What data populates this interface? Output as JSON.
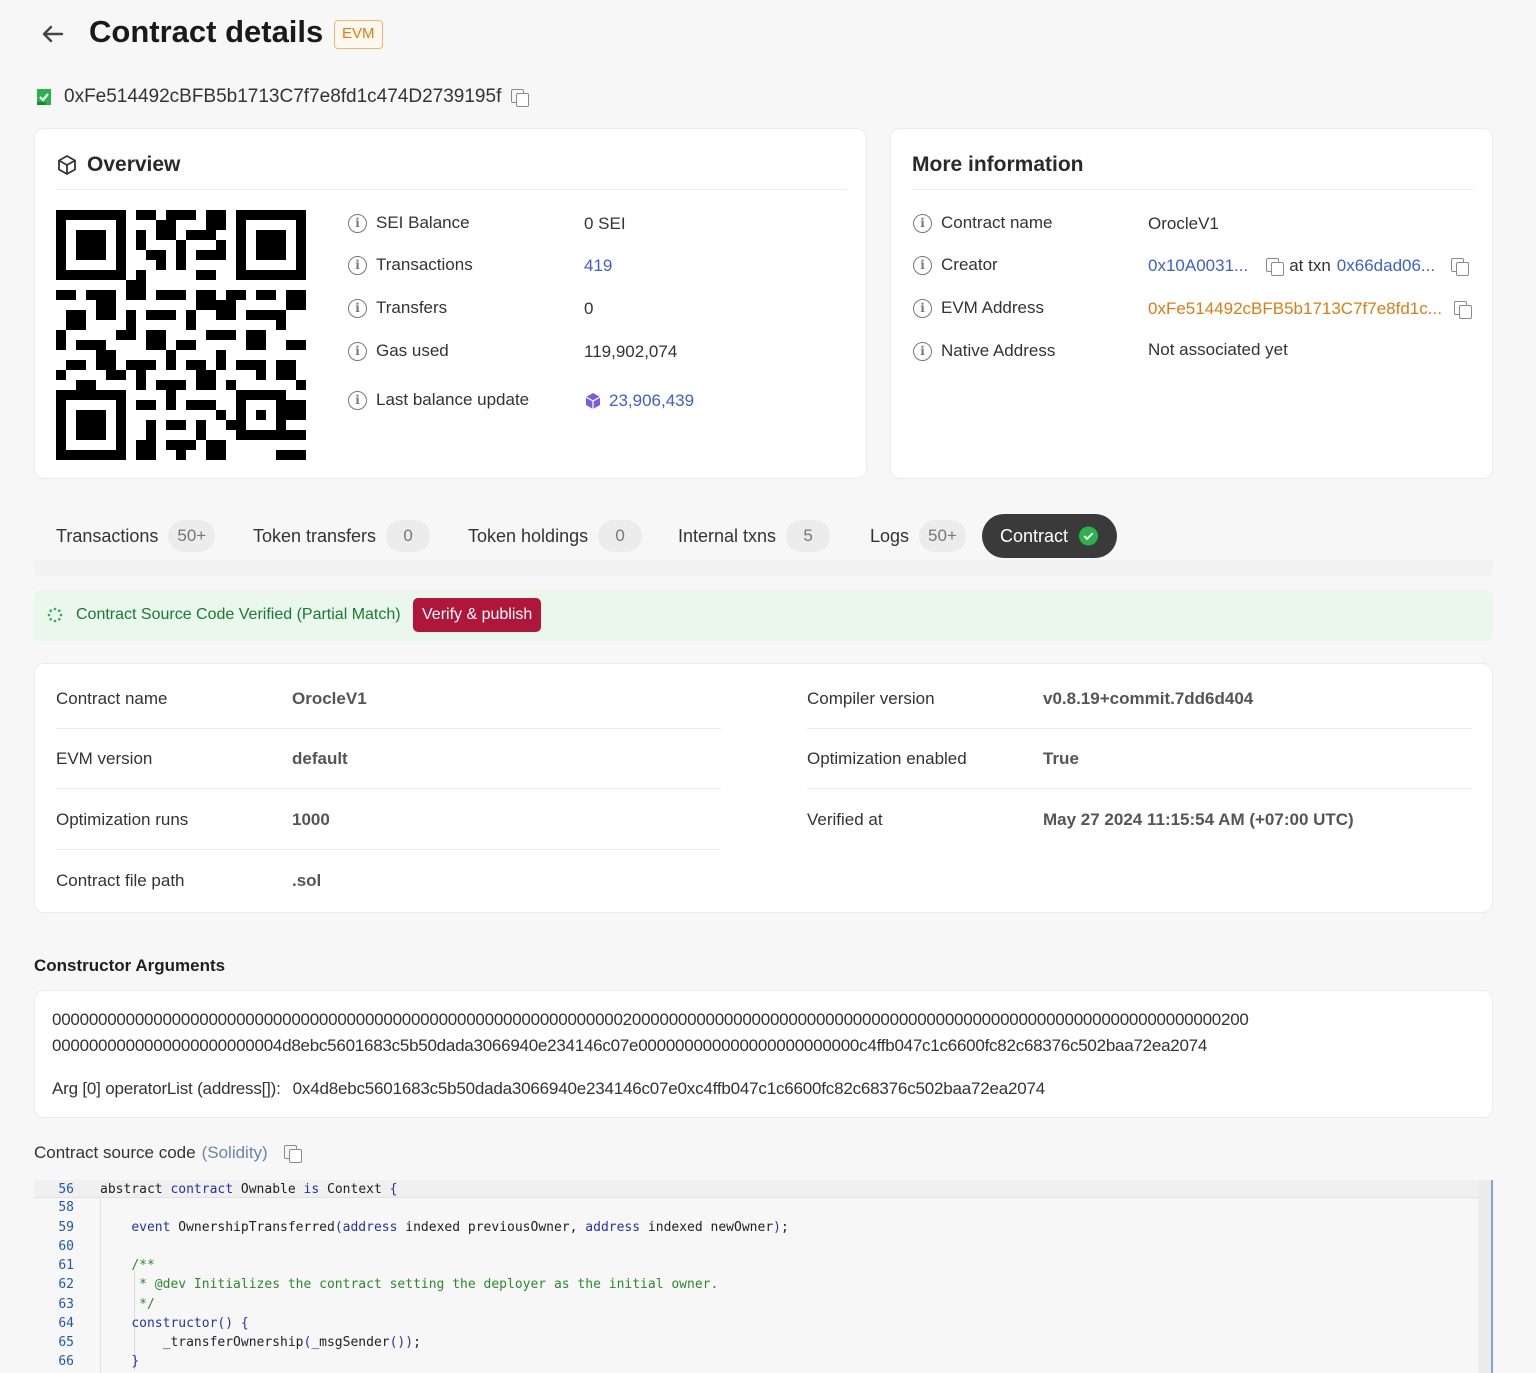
{
  "header": {
    "title": "Contract details",
    "badge": "EVM"
  },
  "address": {
    "value": "0xFe514492cBFB5b1713C7f7e8fd1c474D2739195f"
  },
  "overview": {
    "title": "Overview",
    "rows": [
      {
        "label": "SEI Balance",
        "value": "0 SEI"
      },
      {
        "label": "Transactions",
        "value": "419"
      },
      {
        "label": "Transfers",
        "value": "0"
      },
      {
        "label": "Gas used",
        "value": "119,902,074"
      },
      {
        "label": "Last balance update",
        "value": "23,906,439"
      }
    ]
  },
  "more_info": {
    "title": "More information",
    "contract_name_label": "Contract name",
    "contract_name": "OrocleV1",
    "creator_label": "Creator",
    "creator": "0x10A0031...",
    "at_txn": "at txn",
    "creator_txn": "0x66dad06...",
    "evm_address_label": "EVM Address",
    "evm_address": "0xFe514492cBFB5b1713C7f7e8fd1c...",
    "native_address_label": "Native Address",
    "native_address": "Not associated yet"
  },
  "tabs": [
    {
      "label": "Transactions",
      "count": "50+"
    },
    {
      "label": "Token transfers",
      "count": "0"
    },
    {
      "label": "Token holdings",
      "count": "0"
    },
    {
      "label": "Internal txns",
      "count": "5"
    },
    {
      "label": "Logs",
      "count": "50+"
    },
    {
      "label": "Contract"
    }
  ],
  "verify": {
    "text": "Contract Source Code Verified (Partial Match)",
    "button": "Verify & publish"
  },
  "details": {
    "left": [
      {
        "label": "Contract name",
        "value": "OrocleV1"
      },
      {
        "label": "EVM version",
        "value": "default"
      },
      {
        "label": "Optimization runs",
        "value": "1000"
      },
      {
        "label": "Contract file path",
        "value": ".sol"
      }
    ],
    "right": [
      {
        "label": "Compiler version",
        "value": "v0.8.19+commit.7dd6d404"
      },
      {
        "label": "Optimization enabled",
        "value": "True"
      },
      {
        "label": "Verified at",
        "value": "May 27 2024 11:15:54 AM (+07:00 UTC)"
      }
    ]
  },
  "constructor": {
    "title": "Constructor Arguments",
    "line1": "0000000000000000000000000000000000000000000000000000000000000020000000000000000000000000000000000000000000000000000000000000000200",
    "line2": "0000000000000000000000004d8ebc5601683c5b50dada3066940e234146c07e000000000000000000000000c4ffb047c1c6600fc82c68376c502baa72ea2074",
    "arg_label": "Arg [0] operatorList (address[]):",
    "arg_value": "0x4d8ebc5601683c5b50dada3066940e234146c07e0xc4ffb047c1c6600fc82c68376c502baa72ea2074"
  },
  "source": {
    "title": "Contract source code",
    "lang": "(Solidity)",
    "lines": [
      {
        "n": "56",
        "parts": [
          [
            "",
            "abstract "
          ],
          [
            "kw",
            "contract"
          ],
          [
            "",
            " Ownable "
          ],
          [
            "kw",
            "is"
          ],
          [
            "",
            " Context "
          ],
          [
            "kw",
            "{"
          ]
        ]
      },
      {
        "n": "58",
        "parts": []
      },
      {
        "n": "59",
        "parts": [
          [
            "",
            "    "
          ],
          [
            "kw",
            "event"
          ],
          [
            "",
            " OwnershipTransferred"
          ],
          [
            "kw",
            "("
          ],
          [
            "kw",
            "address"
          ],
          [
            "",
            " indexed previousOwner, "
          ],
          [
            "kw",
            "address"
          ],
          [
            "",
            " indexed newOwner"
          ],
          [
            "kw",
            ")"
          ],
          [
            "",
            ";"
          ]
        ]
      },
      {
        "n": "60",
        "parts": []
      },
      {
        "n": "61",
        "parts": [
          [
            "",
            "    "
          ],
          [
            "cm",
            "/**"
          ]
        ]
      },
      {
        "n": "62",
        "parts": [
          [
            "",
            "    "
          ],
          [
            "cm",
            " * @dev Initializes the contract setting the deployer as the initial owner."
          ]
        ]
      },
      {
        "n": "63",
        "parts": [
          [
            "",
            "    "
          ],
          [
            "cm",
            " */"
          ]
        ]
      },
      {
        "n": "64",
        "parts": [
          [
            "",
            "    "
          ],
          [
            "kw",
            "constructor"
          ],
          [
            "kw",
            "()"
          ],
          [
            "",
            " "
          ],
          [
            "kw",
            "{"
          ]
        ]
      },
      {
        "n": "65",
        "parts": [
          [
            "",
            "        _transferOwnership"
          ],
          [
            "kw",
            "("
          ],
          [
            "",
            "_msgSender"
          ],
          [
            "kw",
            "())"
          ],
          [
            "",
            ";"
          ]
        ]
      },
      {
        "n": "66",
        "parts": [
          [
            "",
            "    "
          ],
          [
            "kw",
            "}"
          ]
        ]
      }
    ]
  },
  "colors": {
    "accent": "#3c5fd8",
    "orange": "#e07b12",
    "verify_button": "#b0163a",
    "verify_bg": "#e9f7ec",
    "active_tab": "#3a3a3a"
  }
}
